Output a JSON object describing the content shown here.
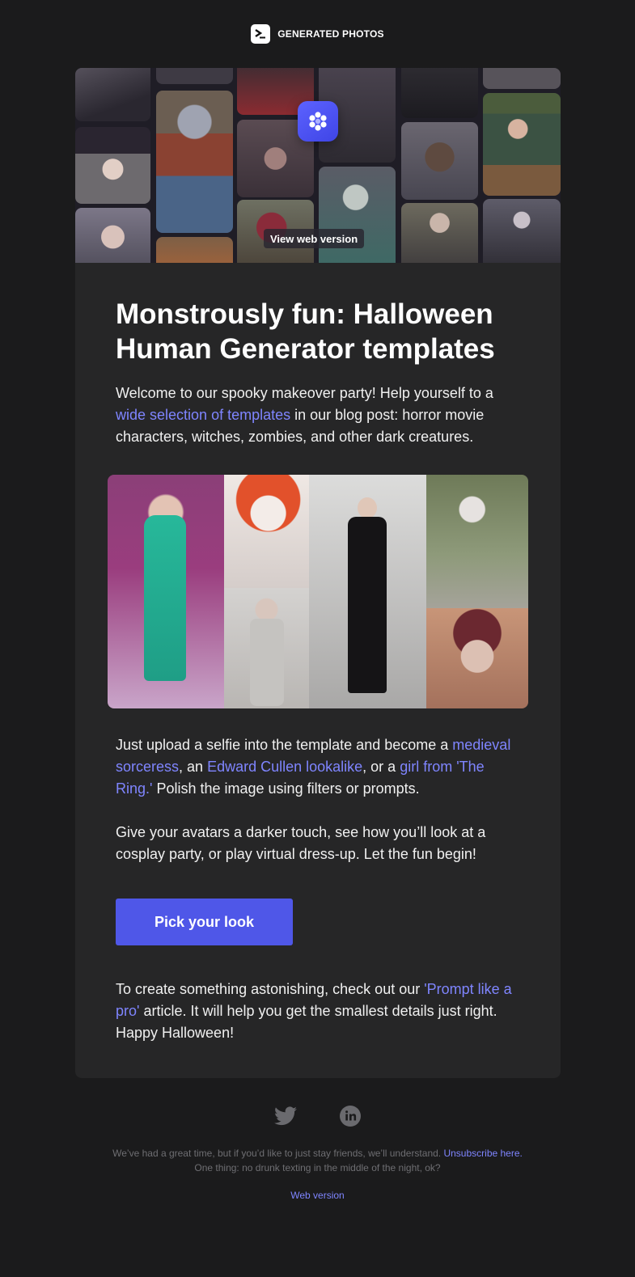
{
  "brand": {
    "name": "GENERATED PHOTOS"
  },
  "hero": {
    "web_version_badge": "View web version",
    "app_icon": "flower-icon"
  },
  "article": {
    "title": "Monstrously fun: Halloween Human Generator templates",
    "intro_before": "Welcome to our spooky makeover party! Help yourself to a ",
    "intro_link": "wide selection of templates",
    "intro_after": " in our blog post: horror movie characters, witches, zombies, and other dark creatures.",
    "p2_text1": "Just upload a selfie into the template and become a ",
    "p2_link1": "medieval sorceress",
    "p2_text2": ", an ",
    "p2_link2": "Edward Cullen lookalike",
    "p2_text3": ", or a ",
    "p2_link3": "girl from 'The Ring.'",
    "p2_text4": " Polish the image using filters or prompts.",
    "p3": "Give your avatars a darker touch, see how you’ll look at a cosplay party, or play virtual dress-up. Let the fun begin!",
    "cta_label": "Pick your look",
    "p4_before": "To create something astonishing, check out our ",
    "p4_link": "'Prompt like a pro'",
    "p4_after": " article. It will help you get the smallest details just right.",
    "p4_closing": "Happy Halloween!"
  },
  "footer": {
    "social": [
      "twitter-icon",
      "linkedin-icon"
    ],
    "line1_before": "We’ve had a great time, but if you’d like to just stay friends, we’ll understand. ",
    "unsubscribe_link": "Unsubscribe here.",
    "line2": "One thing: no drunk texting in the middle of the night, ok?",
    "web_version_link": "Web version"
  },
  "colors": {
    "background": "#1b1b1c",
    "card": "#262627",
    "link": "#7f85ff",
    "cta": "#4f57e8"
  }
}
